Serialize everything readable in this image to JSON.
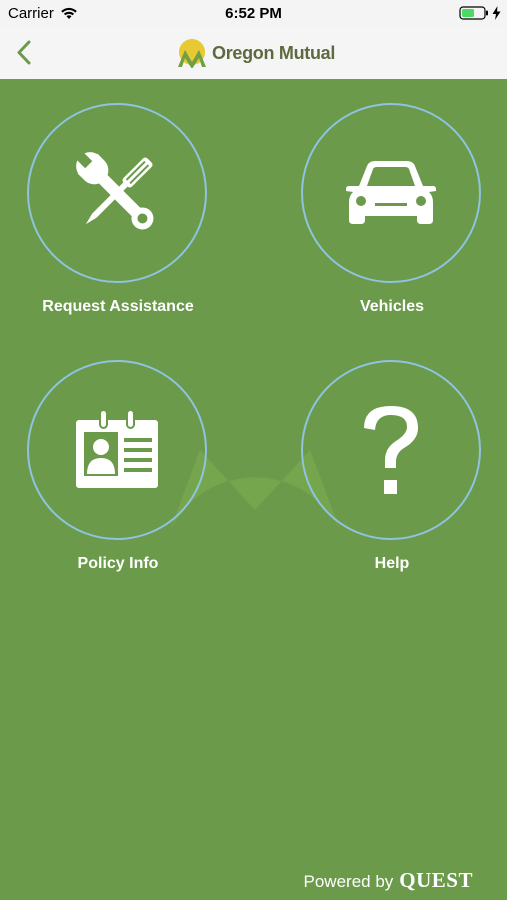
{
  "status_bar": {
    "carrier": "Carrier",
    "time": "6:52 PM",
    "wifi_icon": "wifi-icon",
    "battery_icon": "battery-icon"
  },
  "nav": {
    "back_icon": "chevron-left-icon",
    "brand_name": "Oregon Mutual",
    "brand_logo": "mountain-sun-logo"
  },
  "tiles": [
    {
      "label": "Request Assistance",
      "icon": "tools-icon"
    },
    {
      "label": "Vehicles",
      "icon": "car-icon"
    },
    {
      "label": "Policy Info",
      "icon": "id-card-icon"
    },
    {
      "label": "Help",
      "icon": "question-mark-icon"
    }
  ],
  "footer": {
    "powered_by": "Powered by",
    "brand": "QUEST"
  },
  "colors": {
    "background": "#6b9a4b",
    "circle_border": "#8fc3df",
    "brand_text": "#5d6a3f",
    "logo_yellow": "#e7c933",
    "logo_green": "#6fa043"
  }
}
